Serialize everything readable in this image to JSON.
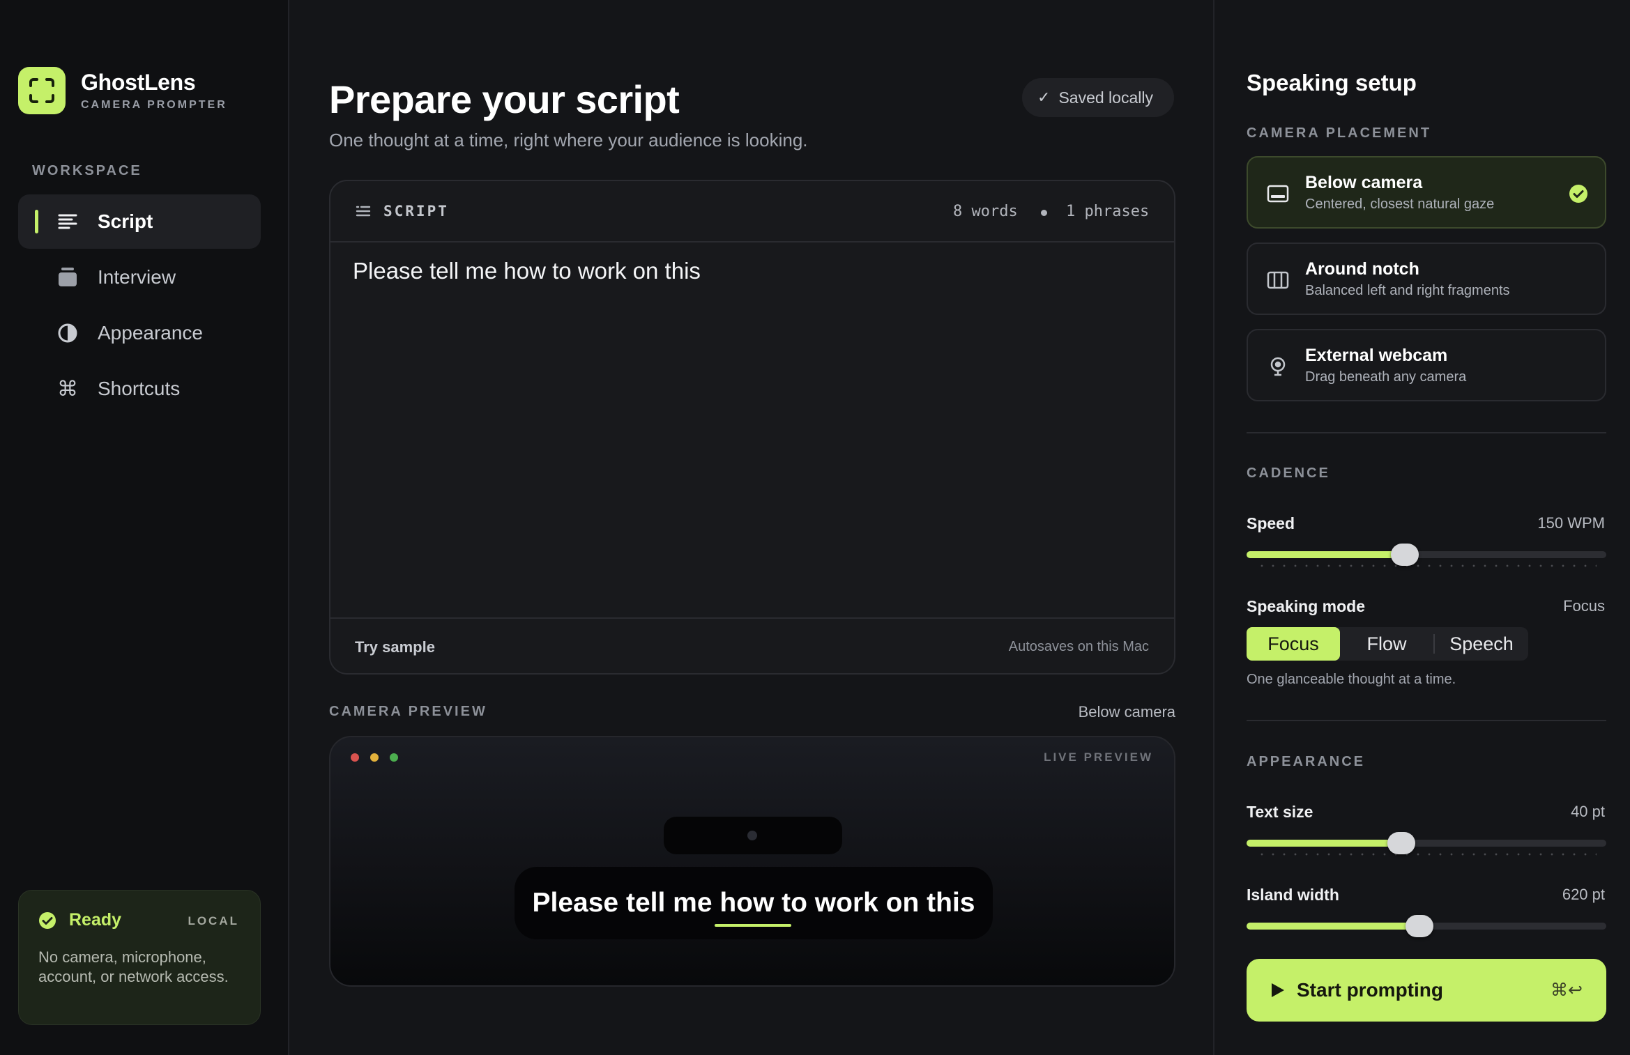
{
  "window": {
    "traffic_colors": [
      "#ed6a5e",
      "#f5bf4f",
      "#61c554"
    ]
  },
  "sidebar": {
    "brand_name": "GhostLens",
    "brand_sub": "CAMERA PROMPTER",
    "section_label": "WORKSPACE",
    "items": [
      {
        "label": "Script",
        "icon": "script-lines-icon",
        "active": true
      },
      {
        "label": "Interview",
        "icon": "stack-icon",
        "active": false
      },
      {
        "label": "Appearance",
        "icon": "half-circle-icon",
        "active": false
      },
      {
        "label": "Shortcuts",
        "icon": "command-key-icon",
        "active": false
      }
    ],
    "status": {
      "title": "Ready",
      "tag": "LOCAL",
      "description": "No camera, microphone, account, or network access."
    }
  },
  "main": {
    "title": "Prepare your script",
    "subtitle": "One thought at a time, right where your audience is looking.",
    "saved_badge": "Saved locally",
    "script_card": {
      "label": "SCRIPT",
      "word_count": "8 words",
      "phrase_count": "1 phrases",
      "text": "Please tell me how to work on this",
      "try_sample": "Try sample",
      "autosave_note": "Autosaves on this Mac"
    },
    "preview": {
      "label": "CAMERA PREVIEW",
      "placement": "Below camera",
      "live_label": "LIVE PREVIEW",
      "text": "Please tell me how to work on this"
    }
  },
  "setup": {
    "title": "Speaking setup",
    "placement_label": "CAMERA PLACEMENT",
    "placements": [
      {
        "title": "Below camera",
        "desc": "Centered, closest natural gaze",
        "icon": "below-camera-icon",
        "selected": true
      },
      {
        "title": "Around notch",
        "desc": "Balanced left and right fragments",
        "icon": "columns-icon",
        "selected": false
      },
      {
        "title": "External webcam",
        "desc": "Drag beneath any camera",
        "icon": "webcam-icon",
        "selected": false
      }
    ],
    "cadence_label": "CADENCE",
    "speed": {
      "label": "Speed",
      "value_text": "150 WPM",
      "fraction": 0.44
    },
    "speaking_mode": {
      "label": "Speaking mode",
      "current": "Focus",
      "options": [
        "Focus",
        "Flow",
        "Speech"
      ],
      "hint": "One glanceable thought at a time."
    },
    "appearance_label": "APPEARANCE",
    "text_size": {
      "label": "Text size",
      "value_text": "40 pt",
      "fraction": 0.43
    },
    "island_width": {
      "label": "Island width",
      "value_text": "620 pt",
      "fraction": 0.48
    },
    "start_button": {
      "label": "Start prompting",
      "shortcut": "⌘↩"
    }
  },
  "colors": {
    "accent": "#c5f069",
    "background": "#141518",
    "sidebar": "#0f1012"
  }
}
